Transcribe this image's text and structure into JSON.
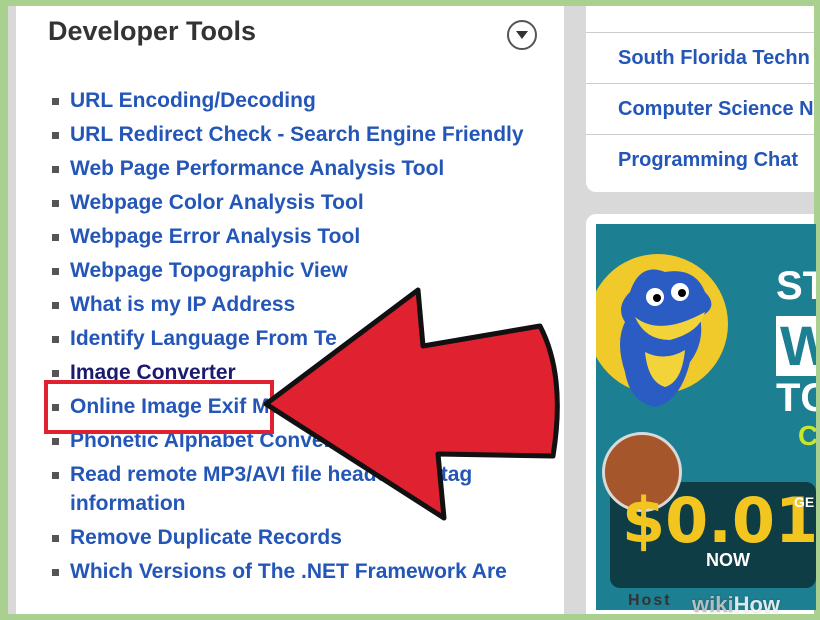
{
  "panel": {
    "title": "Developer Tools",
    "items": [
      {
        "label": "URL Encoding/Decoding"
      },
      {
        "label": "URL Redirect Check - Search Engine Friendly"
      },
      {
        "label": "Web Page Performance Analysis Tool"
      },
      {
        "label": "Webpage Color Analysis Tool"
      },
      {
        "label": "Webpage Error Analysis Tool"
      },
      {
        "label": "Webpage Topographic View"
      },
      {
        "label": "What is my IP Address"
      },
      {
        "label": "Identify Language From Te"
      },
      {
        "label": "Image Converter"
      },
      {
        "label": "Online Image Exif Metadata"
      },
      {
        "label": "Phonetic Alphabet Converter"
      },
      {
        "label": "Read remote MP3/AVI file header/ID3 tag information"
      },
      {
        "label": "Remove Duplicate Records"
      },
      {
        "label": "Which Versions of The .NET Framework Are"
      }
    ]
  },
  "right_links": [
    {
      "label": "South Florida Techn"
    },
    {
      "label": "Computer Science N"
    },
    {
      "label": "Programming Chat"
    }
  ],
  "ad": {
    "headline_top": "STA",
    "headline_w": "W",
    "headline_t": "TC",
    "c_letter": "C",
    "price": "$0.01",
    "now": "NOW",
    "ge": "GE",
    "host": "Host"
  },
  "watermark": {
    "wiki": "wiki",
    "how": "How"
  },
  "colors": {
    "link": "#2456b8",
    "highlight": "#e0212f",
    "arrow": "#e0212f",
    "ad_bg": "#1c7f92"
  }
}
